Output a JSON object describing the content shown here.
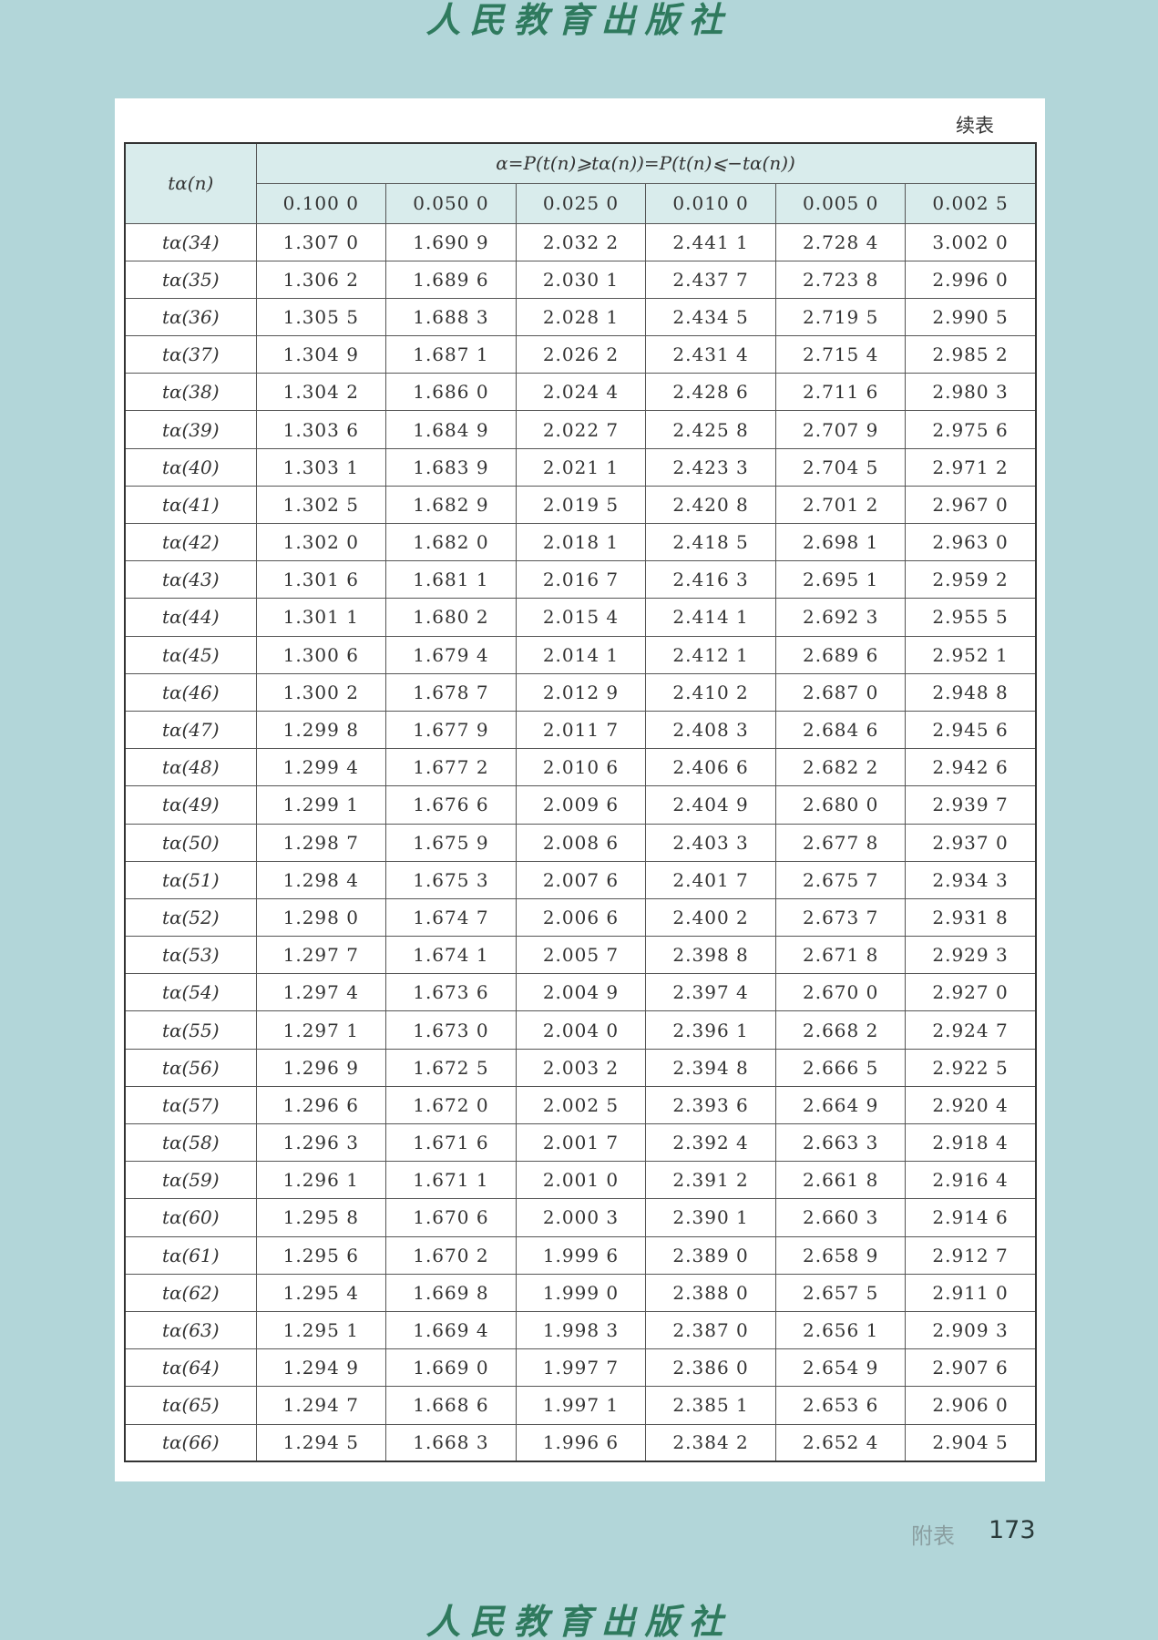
{
  "watermark_top": "人民教育出版社",
  "watermark_bottom": "人民教育出版社",
  "continued_label": "续表",
  "table": {
    "corner_header": "tα(n)",
    "span_header": "α=P(t(n)⩾tα(n))=P(t(n)⩽−tα(n))",
    "alpha_headers": [
      "0.100 0",
      "0.050 0",
      "0.025 0",
      "0.010 0",
      "0.005 0",
      "0.002 5"
    ],
    "rows": [
      {
        "label": "tα(34)",
        "values": [
          "1.307 0",
          "1.690 9",
          "2.032 2",
          "2.441 1",
          "2.728 4",
          "3.002 0"
        ]
      },
      {
        "label": "tα(35)",
        "values": [
          "1.306 2",
          "1.689 6",
          "2.030 1",
          "2.437 7",
          "2.723 8",
          "2.996 0"
        ]
      },
      {
        "label": "tα(36)",
        "values": [
          "1.305 5",
          "1.688 3",
          "2.028 1",
          "2.434 5",
          "2.719 5",
          "2.990 5"
        ]
      },
      {
        "label": "tα(37)",
        "values": [
          "1.304 9",
          "1.687 1",
          "2.026 2",
          "2.431 4",
          "2.715 4",
          "2.985 2"
        ]
      },
      {
        "label": "tα(38)",
        "values": [
          "1.304 2",
          "1.686 0",
          "2.024 4",
          "2.428 6",
          "2.711 6",
          "2.980 3"
        ]
      },
      {
        "label": "tα(39)",
        "values": [
          "1.303 6",
          "1.684 9",
          "2.022 7",
          "2.425 8",
          "2.707 9",
          "2.975 6"
        ]
      },
      {
        "label": "tα(40)",
        "values": [
          "1.303 1",
          "1.683 9",
          "2.021 1",
          "2.423 3",
          "2.704 5",
          "2.971 2"
        ]
      },
      {
        "label": "tα(41)",
        "values": [
          "1.302 5",
          "1.682 9",
          "2.019 5",
          "2.420 8",
          "2.701 2",
          "2.967 0"
        ]
      },
      {
        "label": "tα(42)",
        "values": [
          "1.302 0",
          "1.682 0",
          "2.018 1",
          "2.418 5",
          "2.698 1",
          "2.963 0"
        ]
      },
      {
        "label": "tα(43)",
        "values": [
          "1.301 6",
          "1.681 1",
          "2.016 7",
          "2.416 3",
          "2.695 1",
          "2.959 2"
        ]
      },
      {
        "label": "tα(44)",
        "values": [
          "1.301 1",
          "1.680 2",
          "2.015 4",
          "2.414 1",
          "2.692 3",
          "2.955 5"
        ]
      },
      {
        "label": "tα(45)",
        "values": [
          "1.300 6",
          "1.679 4",
          "2.014 1",
          "2.412 1",
          "2.689 6",
          "2.952 1"
        ]
      },
      {
        "label": "tα(46)",
        "values": [
          "1.300 2",
          "1.678 7",
          "2.012 9",
          "2.410 2",
          "2.687 0",
          "2.948 8"
        ]
      },
      {
        "label": "tα(47)",
        "values": [
          "1.299 8",
          "1.677 9",
          "2.011 7",
          "2.408 3",
          "2.684 6",
          "2.945 6"
        ]
      },
      {
        "label": "tα(48)",
        "values": [
          "1.299 4",
          "1.677 2",
          "2.010 6",
          "2.406 6",
          "2.682 2",
          "2.942 6"
        ]
      },
      {
        "label": "tα(49)",
        "values": [
          "1.299 1",
          "1.676 6",
          "2.009 6",
          "2.404 9",
          "2.680 0",
          "2.939 7"
        ]
      },
      {
        "label": "tα(50)",
        "values": [
          "1.298 7",
          "1.675 9",
          "2.008 6",
          "2.403 3",
          "2.677 8",
          "2.937 0"
        ]
      },
      {
        "label": "tα(51)",
        "values": [
          "1.298 4",
          "1.675 3",
          "2.007 6",
          "2.401 7",
          "2.675 7",
          "2.934 3"
        ]
      },
      {
        "label": "tα(52)",
        "values": [
          "1.298 0",
          "1.674 7",
          "2.006 6",
          "2.400 2",
          "2.673 7",
          "2.931 8"
        ]
      },
      {
        "label": "tα(53)",
        "values": [
          "1.297 7",
          "1.674 1",
          "2.005 7",
          "2.398 8",
          "2.671 8",
          "2.929 3"
        ]
      },
      {
        "label": "tα(54)",
        "values": [
          "1.297 4",
          "1.673 6",
          "2.004 9",
          "2.397 4",
          "2.670 0",
          "2.927 0"
        ]
      },
      {
        "label": "tα(55)",
        "values": [
          "1.297 1",
          "1.673 0",
          "2.004 0",
          "2.396 1",
          "2.668 2",
          "2.924 7"
        ]
      },
      {
        "label": "tα(56)",
        "values": [
          "1.296 9",
          "1.672 5",
          "2.003 2",
          "2.394 8",
          "2.666 5",
          "2.922 5"
        ]
      },
      {
        "label": "tα(57)",
        "values": [
          "1.296 6",
          "1.672 0",
          "2.002 5",
          "2.393 6",
          "2.664 9",
          "2.920 4"
        ]
      },
      {
        "label": "tα(58)",
        "values": [
          "1.296 3",
          "1.671 6",
          "2.001 7",
          "2.392 4",
          "2.663 3",
          "2.918 4"
        ]
      },
      {
        "label": "tα(59)",
        "values": [
          "1.296 1",
          "1.671 1",
          "2.001 0",
          "2.391 2",
          "2.661 8",
          "2.916 4"
        ]
      },
      {
        "label": "tα(60)",
        "values": [
          "1.295 8",
          "1.670 6",
          "2.000 3",
          "2.390 1",
          "2.660 3",
          "2.914 6"
        ]
      },
      {
        "label": "tα(61)",
        "values": [
          "1.295 6",
          "1.670 2",
          "1.999 6",
          "2.389 0",
          "2.658 9",
          "2.912 7"
        ]
      },
      {
        "label": "tα(62)",
        "values": [
          "1.295 4",
          "1.669 8",
          "1.999 0",
          "2.388 0",
          "2.657 5",
          "2.911 0"
        ]
      },
      {
        "label": "tα(63)",
        "values": [
          "1.295 1",
          "1.669 4",
          "1.998 3",
          "2.387 0",
          "2.656 1",
          "2.909 3"
        ]
      },
      {
        "label": "tα(64)",
        "values": [
          "1.294 9",
          "1.669 0",
          "1.997 7",
          "2.386 0",
          "2.654 9",
          "2.907 6"
        ]
      },
      {
        "label": "tα(65)",
        "values": [
          "1.294 7",
          "1.668 6",
          "1.997 1",
          "2.385 1",
          "2.653 6",
          "2.906 0"
        ]
      },
      {
        "label": "tα(66)",
        "values": [
          "1.294 5",
          "1.668 3",
          "1.996 6",
          "2.384 2",
          "2.652 4",
          "2.904 5"
        ]
      }
    ]
  },
  "footer": {
    "section_label": "附表",
    "page_number": "173"
  }
}
